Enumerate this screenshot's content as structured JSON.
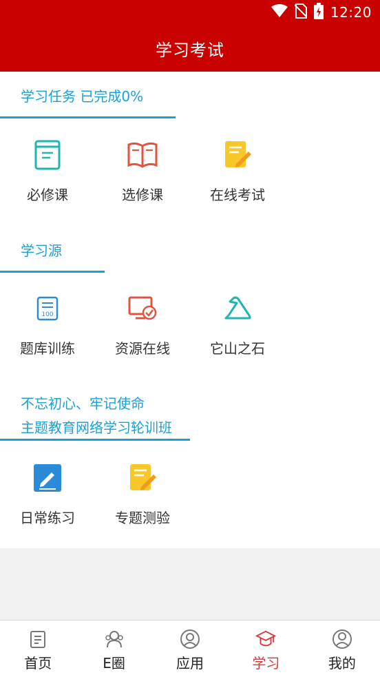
{
  "status_bar": {
    "time": "12:20"
  },
  "header": {
    "title": "学习考试"
  },
  "sections": [
    {
      "heading": "学习任务   已完成0%",
      "items": [
        {
          "label": "必修课",
          "icon": "book-closed-icon"
        },
        {
          "label": "选修课",
          "icon": "book-open-icon"
        },
        {
          "label": "在线考试",
          "icon": "exam-edit-icon"
        }
      ]
    },
    {
      "heading": "学习源",
      "items": [
        {
          "label": "题库训练",
          "icon": "question-bank-icon"
        },
        {
          "label": "资源在线",
          "icon": "monitor-check-icon"
        },
        {
          "label": "它山之石",
          "icon": "mountain-stone-icon"
        }
      ]
    },
    {
      "heading_line1": "不忘初心、牢记使命",
      "heading_line2": "主题教育网络学习轮训班",
      "items": [
        {
          "label": "日常练习",
          "icon": "pen-square-icon"
        },
        {
          "label": "专题测验",
          "icon": "quiz-edit-icon"
        }
      ]
    }
  ],
  "tabbar": {
    "tabs": [
      {
        "label": "首页",
        "icon": "document-icon"
      },
      {
        "label": "E圈",
        "icon": "group-icon"
      },
      {
        "label": "应用",
        "icon": "user-circle-icon"
      },
      {
        "label": "学习",
        "icon": "graduation-cap-icon",
        "active": true
      },
      {
        "label": "我的",
        "icon": "profile-icon"
      }
    ],
    "active_color": "#d9363e"
  },
  "colors": {
    "brand_red": "#c90000",
    "accent_blue": "#1aa1d6"
  }
}
